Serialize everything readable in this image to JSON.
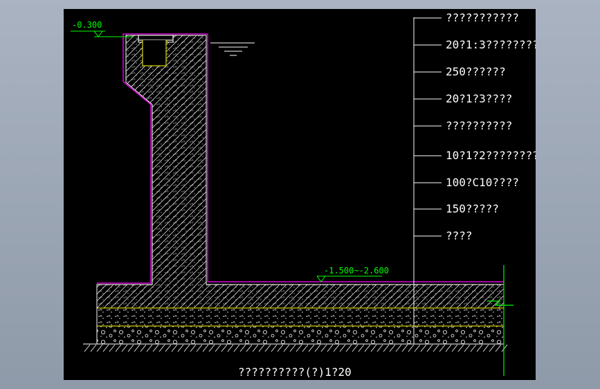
{
  "drawing": {
    "elevation_top": "-0.300",
    "elevation_bottom": "-1.500~-2.600",
    "title": "??????????(?)1?20",
    "layer_labels": [
      "???????????",
      "20?1:3????????",
      "250??????",
      "20?1?3????",
      "??????????",
      "10?1?2????????",
      "100?C10????",
      "150?????",
      "????"
    ]
  },
  "colors": {
    "background": "#000000",
    "linework": "#ffffff",
    "membrane": "#ff00ff",
    "layer_line": "#ffff00",
    "level_marker": "#00ff00"
  }
}
